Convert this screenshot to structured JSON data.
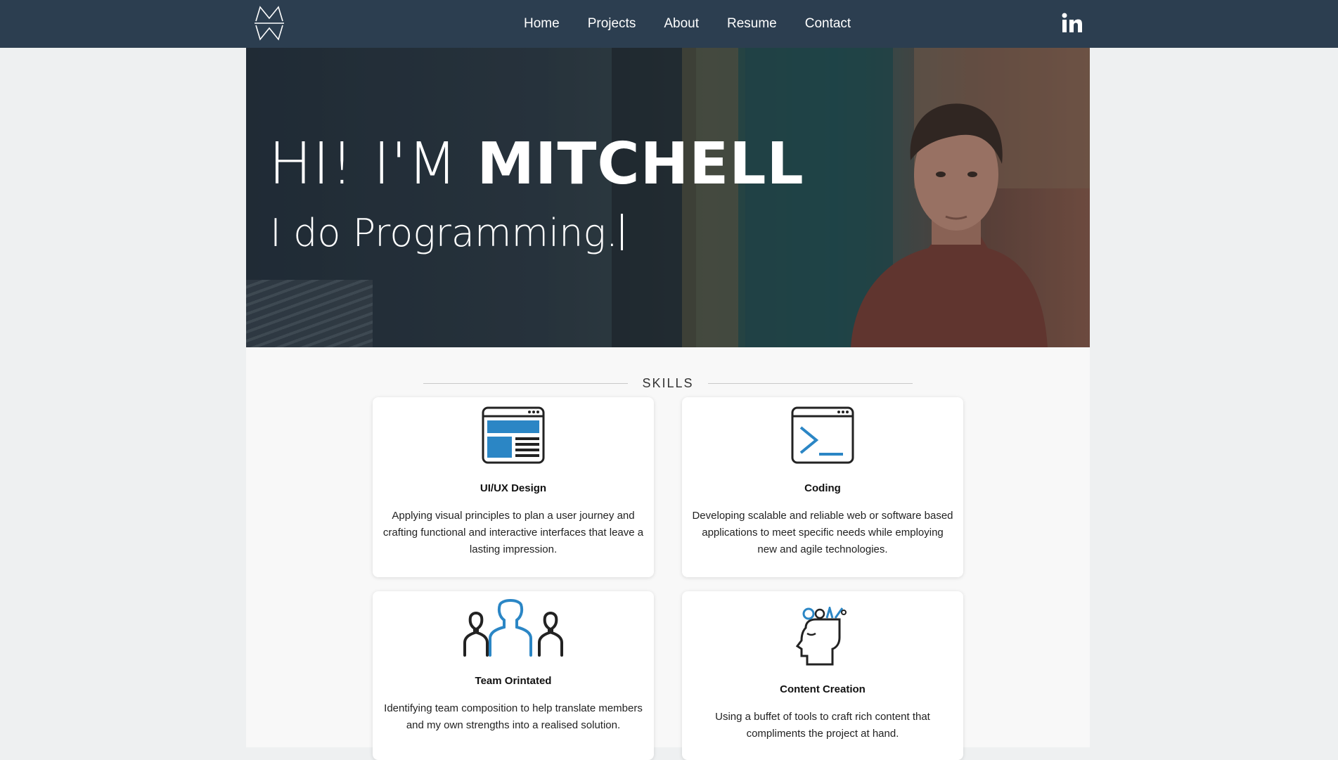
{
  "nav": {
    "logo_text": "MW",
    "links": [
      "Home",
      "Projects",
      "About",
      "Resume",
      "Contact"
    ],
    "social_icon": "linkedin-icon"
  },
  "hero": {
    "greeting": "HI! I'M",
    "name": "MITCHELL",
    "tagline": "I do Programming."
  },
  "skills": {
    "title": "SKILLS",
    "cards": [
      {
        "icon": "browser-layout-icon",
        "title": "UI/UX Design",
        "description": "Applying visual principles to plan a user journey and crafting functional and interactive interfaces that leave a lasting impression."
      },
      {
        "icon": "terminal-icon",
        "title": "Coding",
        "description": "Developing scalable and reliable web or software based applications to meet specific needs while employing new and agile technologies."
      },
      {
        "icon": "team-icon",
        "title": "Team Orintated",
        "description": "Identifying team composition to help translate members and my own strengths into a realised solution."
      },
      {
        "icon": "creative-head-icon",
        "title": "Content Creation",
        "description": "Using a buffet of tools to craft rich content that compliments the project at hand."
      }
    ]
  },
  "colors": {
    "navbar": "#2c3e50",
    "accent_blue": "#2b86c5",
    "page_bg": "#eef0f1"
  }
}
